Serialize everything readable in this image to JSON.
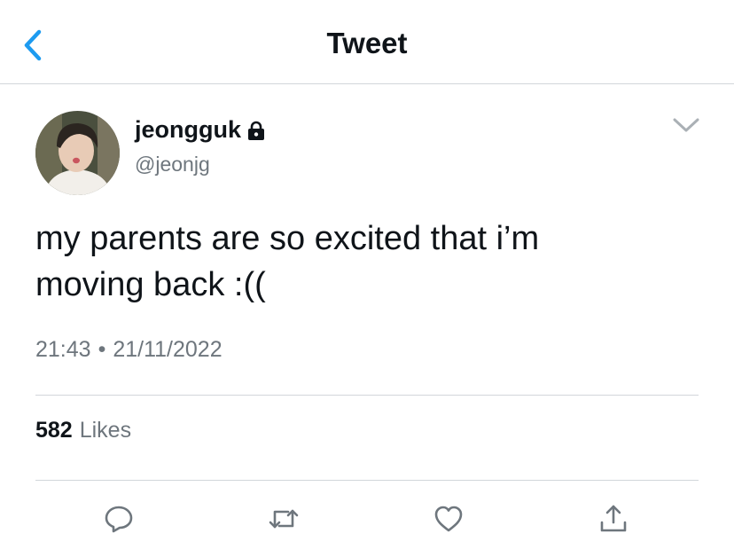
{
  "header": {
    "title": "Tweet"
  },
  "tweet": {
    "display_name": "jeongguk",
    "handle": "@jeonjg",
    "protected": true,
    "text_line1": "my parents are so excited that i’m",
    "text_line2": "moving back :((",
    "time": "21:43",
    "separator": "•",
    "date": "21/11/2022",
    "likes_count": "582",
    "likes_label": "Likes"
  },
  "icons": {
    "back": "chevron-left-icon",
    "lock": "lock-icon",
    "menu": "chevron-down-icon",
    "reply": "reply-icon",
    "retweet": "retweet-icon",
    "like": "heart-icon",
    "share": "share-icon"
  },
  "colors": {
    "accent": "#1d9bf0",
    "text": "#0f1419",
    "secondary": "#6e767d",
    "divider": "#d2d6da"
  }
}
